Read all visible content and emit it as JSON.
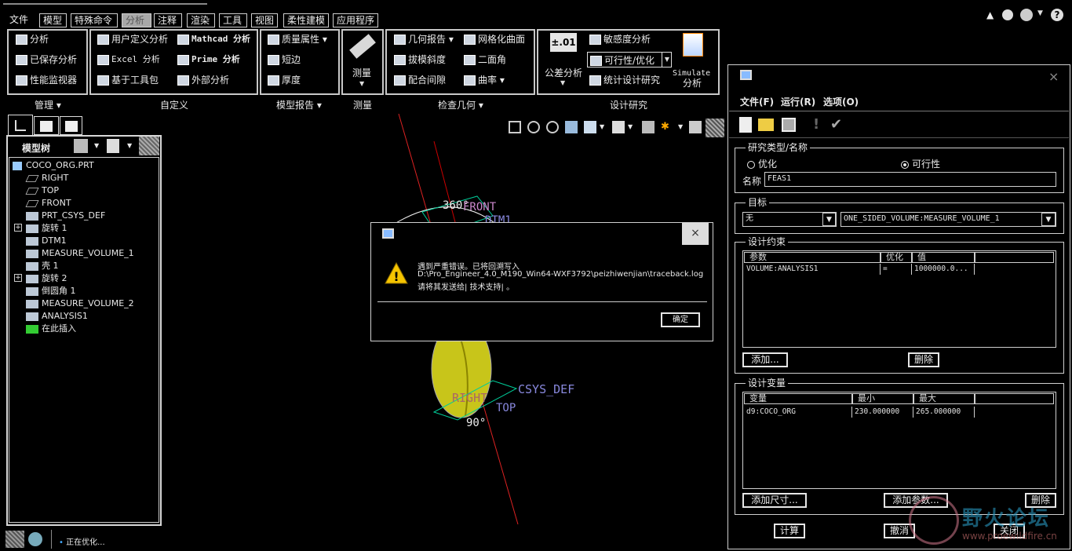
{
  "menu": {
    "file": "文件",
    "tabs": [
      "模型",
      "特殊命令",
      "分析",
      "注释",
      "渲染",
      "工具",
      "视图",
      "柔性建模",
      "应用程序"
    ]
  },
  "ribbon": {
    "manage": {
      "items": [
        "分析",
        "已保存分析",
        "性能监视器"
      ],
      "label": "管理"
    },
    "custom": {
      "items": [
        "用户定义分析",
        "Excel 分析",
        "基于工具包",
        "Mathcad 分析",
        "Prime 分析",
        "外部分析"
      ],
      "label": "自定义"
    },
    "report": {
      "items": [
        "质量属性",
        "短边",
        "厚度"
      ],
      "label": "模型报告"
    },
    "measure": {
      "item": "测量",
      "label": "测量"
    },
    "check": {
      "items": [
        "几何报告",
        "拔模斜度",
        "配合间隙",
        "网格化曲面",
        "二面角",
        "曲率"
      ],
      "label": "检查几何"
    },
    "design": {
      "tolerance_icon": "±.01",
      "tolerance": "公差分析",
      "sensitivity": "敏感度分析",
      "feasibility": "可行性/优化",
      "statistical": "统计设计研究",
      "simulate": "Simulate",
      "simulate_sub": "分析",
      "label": "设计研究"
    }
  },
  "tree": {
    "title": "模型树",
    "root": "COCO_ORG.PRT",
    "items": [
      "RIGHT",
      "TOP",
      "FRONT",
      "PRT_CSYS_DEF",
      "旋转 1",
      "DTM1",
      "MEASURE_VOLUME_1",
      "壳 1",
      "旋转 2",
      "倒圆角 1",
      "MEASURE_VOLUME_2",
      "ANALYSIS1",
      "在此插入"
    ]
  },
  "status": {
    "message": "正在优化..."
  },
  "viewport": {
    "labels": {
      "dim1": "360°",
      "front": "FRONT",
      "dtm": "DTM1",
      "csys": "CSYS_DEF",
      "top": "TOP",
      "right": "RIGHT",
      "dim2": "90°"
    }
  },
  "dialog": {
    "line1": "遇到严重错误。已将回溯写入",
    "line2": "D:\\Pro_Engineer_4.0_M190_Win64-WXF3792\\peizhiwenjian\\traceback.log",
    "line3": "请将其发送给| 技术支持| 。",
    "ok": "确定",
    "close": "×"
  },
  "panel": {
    "close": "×",
    "menu": [
      "文件(F)",
      "运行(R)",
      "选项(O)"
    ],
    "study": {
      "title": "研究类型/名称",
      "opt": "优化",
      "feas": "可行性",
      "name_label": "名称",
      "name_value": "FEAS1"
    },
    "goal": {
      "title": "目标",
      "left": "无",
      "right": "ONE_SIDED_VOLUME:MEASURE_VOLUME_1"
    },
    "constraints": {
      "title": "设计约束",
      "headers": [
        "参数",
        "优化",
        "值"
      ],
      "row": [
        "VOLUME:ANALYSIS1",
        "=",
        "1000000.0..."
      ],
      "add": "添加...",
      "delete": "删除"
    },
    "variables": {
      "title": "设计变量",
      "headers": [
        "变量",
        "最小",
        "最大"
      ],
      "row": [
        "d9:COCO_ORG",
        "230.000000",
        "265.000000"
      ],
      "add_dim": "添加尺寸...",
      "add_param": "添加参数...",
      "delete": "删除"
    },
    "compute": "计算",
    "cancel": "撤消",
    "close_btn": "关闭"
  },
  "watermark": {
    "title": "野火论坛",
    "url": "www.proewildfire.cn"
  }
}
